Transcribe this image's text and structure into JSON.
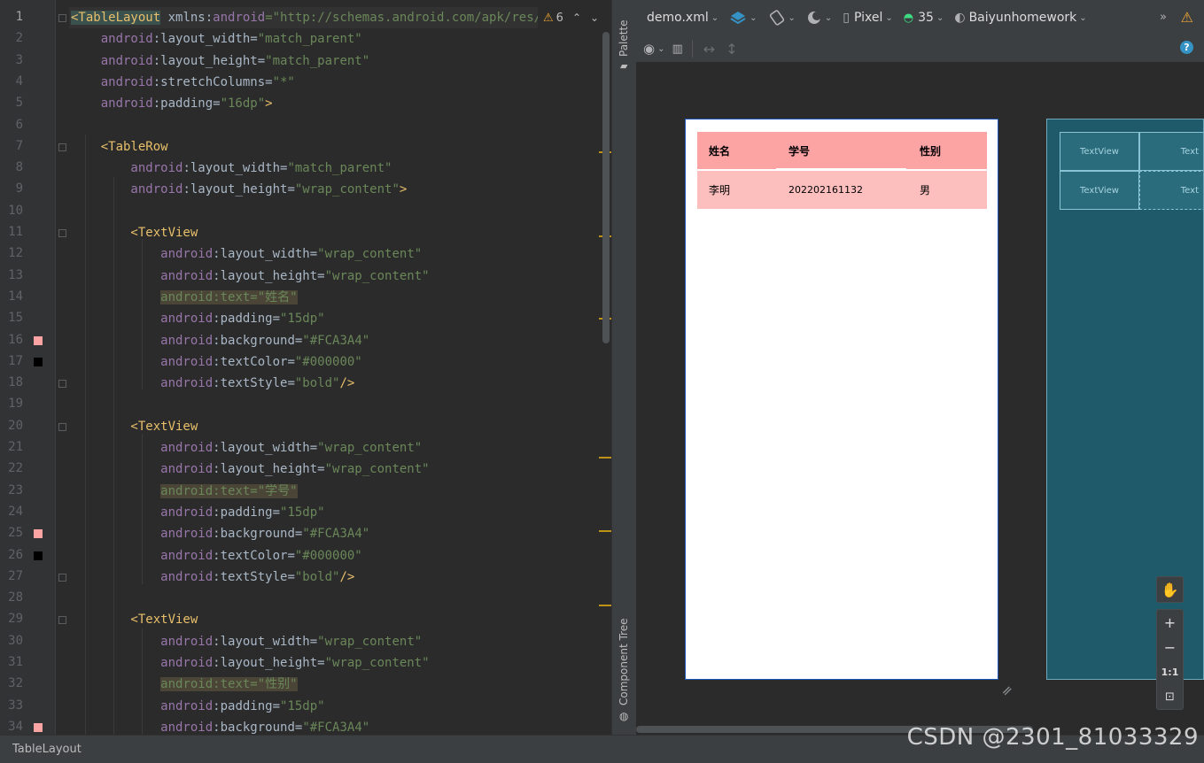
{
  "editor": {
    "line_numbers": [
      "1",
      "2",
      "3",
      "4",
      "5",
      "6",
      "7",
      "8",
      "9",
      "10",
      "11",
      "12",
      "13",
      "14",
      "15",
      "16",
      "17",
      "18",
      "19",
      "20",
      "21",
      "22",
      "23",
      "24",
      "25",
      "26",
      "27",
      "28",
      "29",
      "30",
      "31",
      "32",
      "33",
      "34"
    ],
    "warnings": {
      "count": "6",
      "icon": "warning-icon"
    },
    "lines": [
      {
        "segs": [
          {
            "t": "<TableLayout",
            "c": "tag hl1"
          },
          {
            "t": " xmlns:",
            "c": "plain"
          },
          {
            "t": "android",
            "c": "attr"
          },
          {
            "t": "=\"http://schemas.android.com/apk/res/and",
            "c": "val"
          }
        ]
      },
      {
        "segs": [
          {
            "t": "    android",
            "c": "ns"
          },
          {
            "t": ":layout_width=",
            "c": "plain"
          },
          {
            "t": "\"match_parent\"",
            "c": "val"
          }
        ]
      },
      {
        "segs": [
          {
            "t": "    android",
            "c": "ns"
          },
          {
            "t": ":layout_height=",
            "c": "plain"
          },
          {
            "t": "\"match_parent\"",
            "c": "val"
          }
        ]
      },
      {
        "segs": [
          {
            "t": "    android",
            "c": "ns"
          },
          {
            "t": ":stretchColumns=",
            "c": "plain"
          },
          {
            "t": "\"*\"",
            "c": "val"
          }
        ]
      },
      {
        "segs": [
          {
            "t": "    android",
            "c": "ns"
          },
          {
            "t": ":padding=",
            "c": "plain"
          },
          {
            "t": "\"16dp\"",
            "c": "val"
          },
          {
            "t": ">",
            "c": "tag"
          }
        ]
      },
      {
        "segs": []
      },
      {
        "segs": [
          {
            "t": "    <TableRow",
            "c": "tag"
          }
        ]
      },
      {
        "segs": [
          {
            "t": "        android",
            "c": "ns"
          },
          {
            "t": ":layout_width=",
            "c": "plain"
          },
          {
            "t": "\"match_parent\"",
            "c": "val"
          }
        ]
      },
      {
        "segs": [
          {
            "t": "        android",
            "c": "ns"
          },
          {
            "t": ":layout_height=",
            "c": "plain"
          },
          {
            "t": "\"wrap_content\"",
            "c": "val"
          },
          {
            "t": ">",
            "c": "tag"
          }
        ]
      },
      {
        "segs": []
      },
      {
        "segs": [
          {
            "t": "        <TextView",
            "c": "tag"
          }
        ]
      },
      {
        "segs": [
          {
            "t": "            android",
            "c": "ns"
          },
          {
            "t": ":layout_width=",
            "c": "plain"
          },
          {
            "t": "\"wrap_content\"",
            "c": "val"
          }
        ]
      },
      {
        "segs": [
          {
            "t": "            android",
            "c": "ns"
          },
          {
            "t": ":layout_height=",
            "c": "plain"
          },
          {
            "t": "\"wrap_content\"",
            "c": "val"
          }
        ]
      },
      {
        "segs": [
          {
            "t": "            ",
            "c": "plain"
          },
          {
            "t": "android:text=\"姓名\"",
            "c": "hl val"
          }
        ]
      },
      {
        "segs": [
          {
            "t": "            android",
            "c": "ns"
          },
          {
            "t": ":padding=",
            "c": "plain"
          },
          {
            "t": "\"15dp\"",
            "c": "val"
          }
        ]
      },
      {
        "segs": [
          {
            "t": "            android",
            "c": "ns"
          },
          {
            "t": ":background=",
            "c": "plain"
          },
          {
            "t": "\"#FCA3A4\"",
            "c": "val"
          }
        ]
      },
      {
        "segs": [
          {
            "t": "            android",
            "c": "ns"
          },
          {
            "t": ":textColor=",
            "c": "plain"
          },
          {
            "t": "\"#000000\"",
            "c": "val"
          }
        ]
      },
      {
        "segs": [
          {
            "t": "            android",
            "c": "ns"
          },
          {
            "t": ":textStyle=",
            "c": "plain"
          },
          {
            "t": "\"bold\"",
            "c": "val"
          },
          {
            "t": "/>",
            "c": "tag"
          }
        ]
      },
      {
        "segs": []
      },
      {
        "segs": [
          {
            "t": "        <TextView",
            "c": "tag"
          }
        ]
      },
      {
        "segs": [
          {
            "t": "            android",
            "c": "ns"
          },
          {
            "t": ":layout_width=",
            "c": "plain"
          },
          {
            "t": "\"wrap_content\"",
            "c": "val"
          }
        ]
      },
      {
        "segs": [
          {
            "t": "            android",
            "c": "ns"
          },
          {
            "t": ":layout_height=",
            "c": "plain"
          },
          {
            "t": "\"wrap_content\"",
            "c": "val"
          }
        ]
      },
      {
        "segs": [
          {
            "t": "            ",
            "c": "plain"
          },
          {
            "t": "android:text=\"学号\"",
            "c": "hl val"
          }
        ]
      },
      {
        "segs": [
          {
            "t": "            android",
            "c": "ns"
          },
          {
            "t": ":padding=",
            "c": "plain"
          },
          {
            "t": "\"15dp\"",
            "c": "val"
          }
        ]
      },
      {
        "segs": [
          {
            "t": "            android",
            "c": "ns"
          },
          {
            "t": ":background=",
            "c": "plain"
          },
          {
            "t": "\"#FCA3A4\"",
            "c": "val"
          }
        ]
      },
      {
        "segs": [
          {
            "t": "            android",
            "c": "ns"
          },
          {
            "t": ":textColor=",
            "c": "plain"
          },
          {
            "t": "\"#000000\"",
            "c": "val"
          }
        ]
      },
      {
        "segs": [
          {
            "t": "            android",
            "c": "ns"
          },
          {
            "t": ":textStyle=",
            "c": "plain"
          },
          {
            "t": "\"bold\"",
            "c": "val"
          },
          {
            "t": "/>",
            "c": "tag"
          }
        ]
      },
      {
        "segs": []
      },
      {
        "segs": [
          {
            "t": "        <TextView",
            "c": "tag"
          }
        ]
      },
      {
        "segs": [
          {
            "t": "            android",
            "c": "ns"
          },
          {
            "t": ":layout_width=",
            "c": "plain"
          },
          {
            "t": "\"wrap_content\"",
            "c": "val"
          }
        ]
      },
      {
        "segs": [
          {
            "t": "            android",
            "c": "ns"
          },
          {
            "t": ":layout_height=",
            "c": "plain"
          },
          {
            "t": "\"wrap_content\"",
            "c": "val"
          }
        ]
      },
      {
        "segs": [
          {
            "t": "            ",
            "c": "plain"
          },
          {
            "t": "android:text=\"性别\"",
            "c": "hl val"
          }
        ]
      },
      {
        "segs": [
          {
            "t": "            android",
            "c": "ns"
          },
          {
            "t": ":padding=",
            "c": "plain"
          },
          {
            "t": "\"15dp\"",
            "c": "val"
          }
        ]
      },
      {
        "segs": [
          {
            "t": "            android",
            "c": "ns"
          },
          {
            "t": ":background=",
            "c": "plain"
          },
          {
            "t": "\"#FCA3A4\"",
            "c": "val"
          }
        ]
      }
    ],
    "swatches": [
      {
        "line": 16,
        "color": "#FCA3A4"
      },
      {
        "line": 17,
        "color": "#000000"
      },
      {
        "line": 25,
        "color": "#FCA3A4"
      },
      {
        "line": 26,
        "color": "#000000"
      },
      {
        "line": 34,
        "color": "#FCA3A4"
      }
    ]
  },
  "side_strip": {
    "palette_label": "Palette",
    "component_tree_label": "Component Tree"
  },
  "toolbar": {
    "file": "demo.xml",
    "device": "Pixel",
    "api": "35",
    "theme": "Baiyunhomework"
  },
  "preview": {
    "header_bg": "#FCA3A4",
    "row_bg": "#FDBEBE",
    "headers": [
      "姓名",
      "学号",
      "性别"
    ],
    "row": [
      "李明",
      "202202161132",
      "男"
    ]
  },
  "blueprint": {
    "cells": [
      "TextView",
      "Text",
      "TextView",
      "Text"
    ]
  },
  "zoom": {
    "fit_label": "1:1"
  },
  "status": {
    "breadcrumb": "TableLayout"
  },
  "watermark": "CSDN @2301_81033329"
}
